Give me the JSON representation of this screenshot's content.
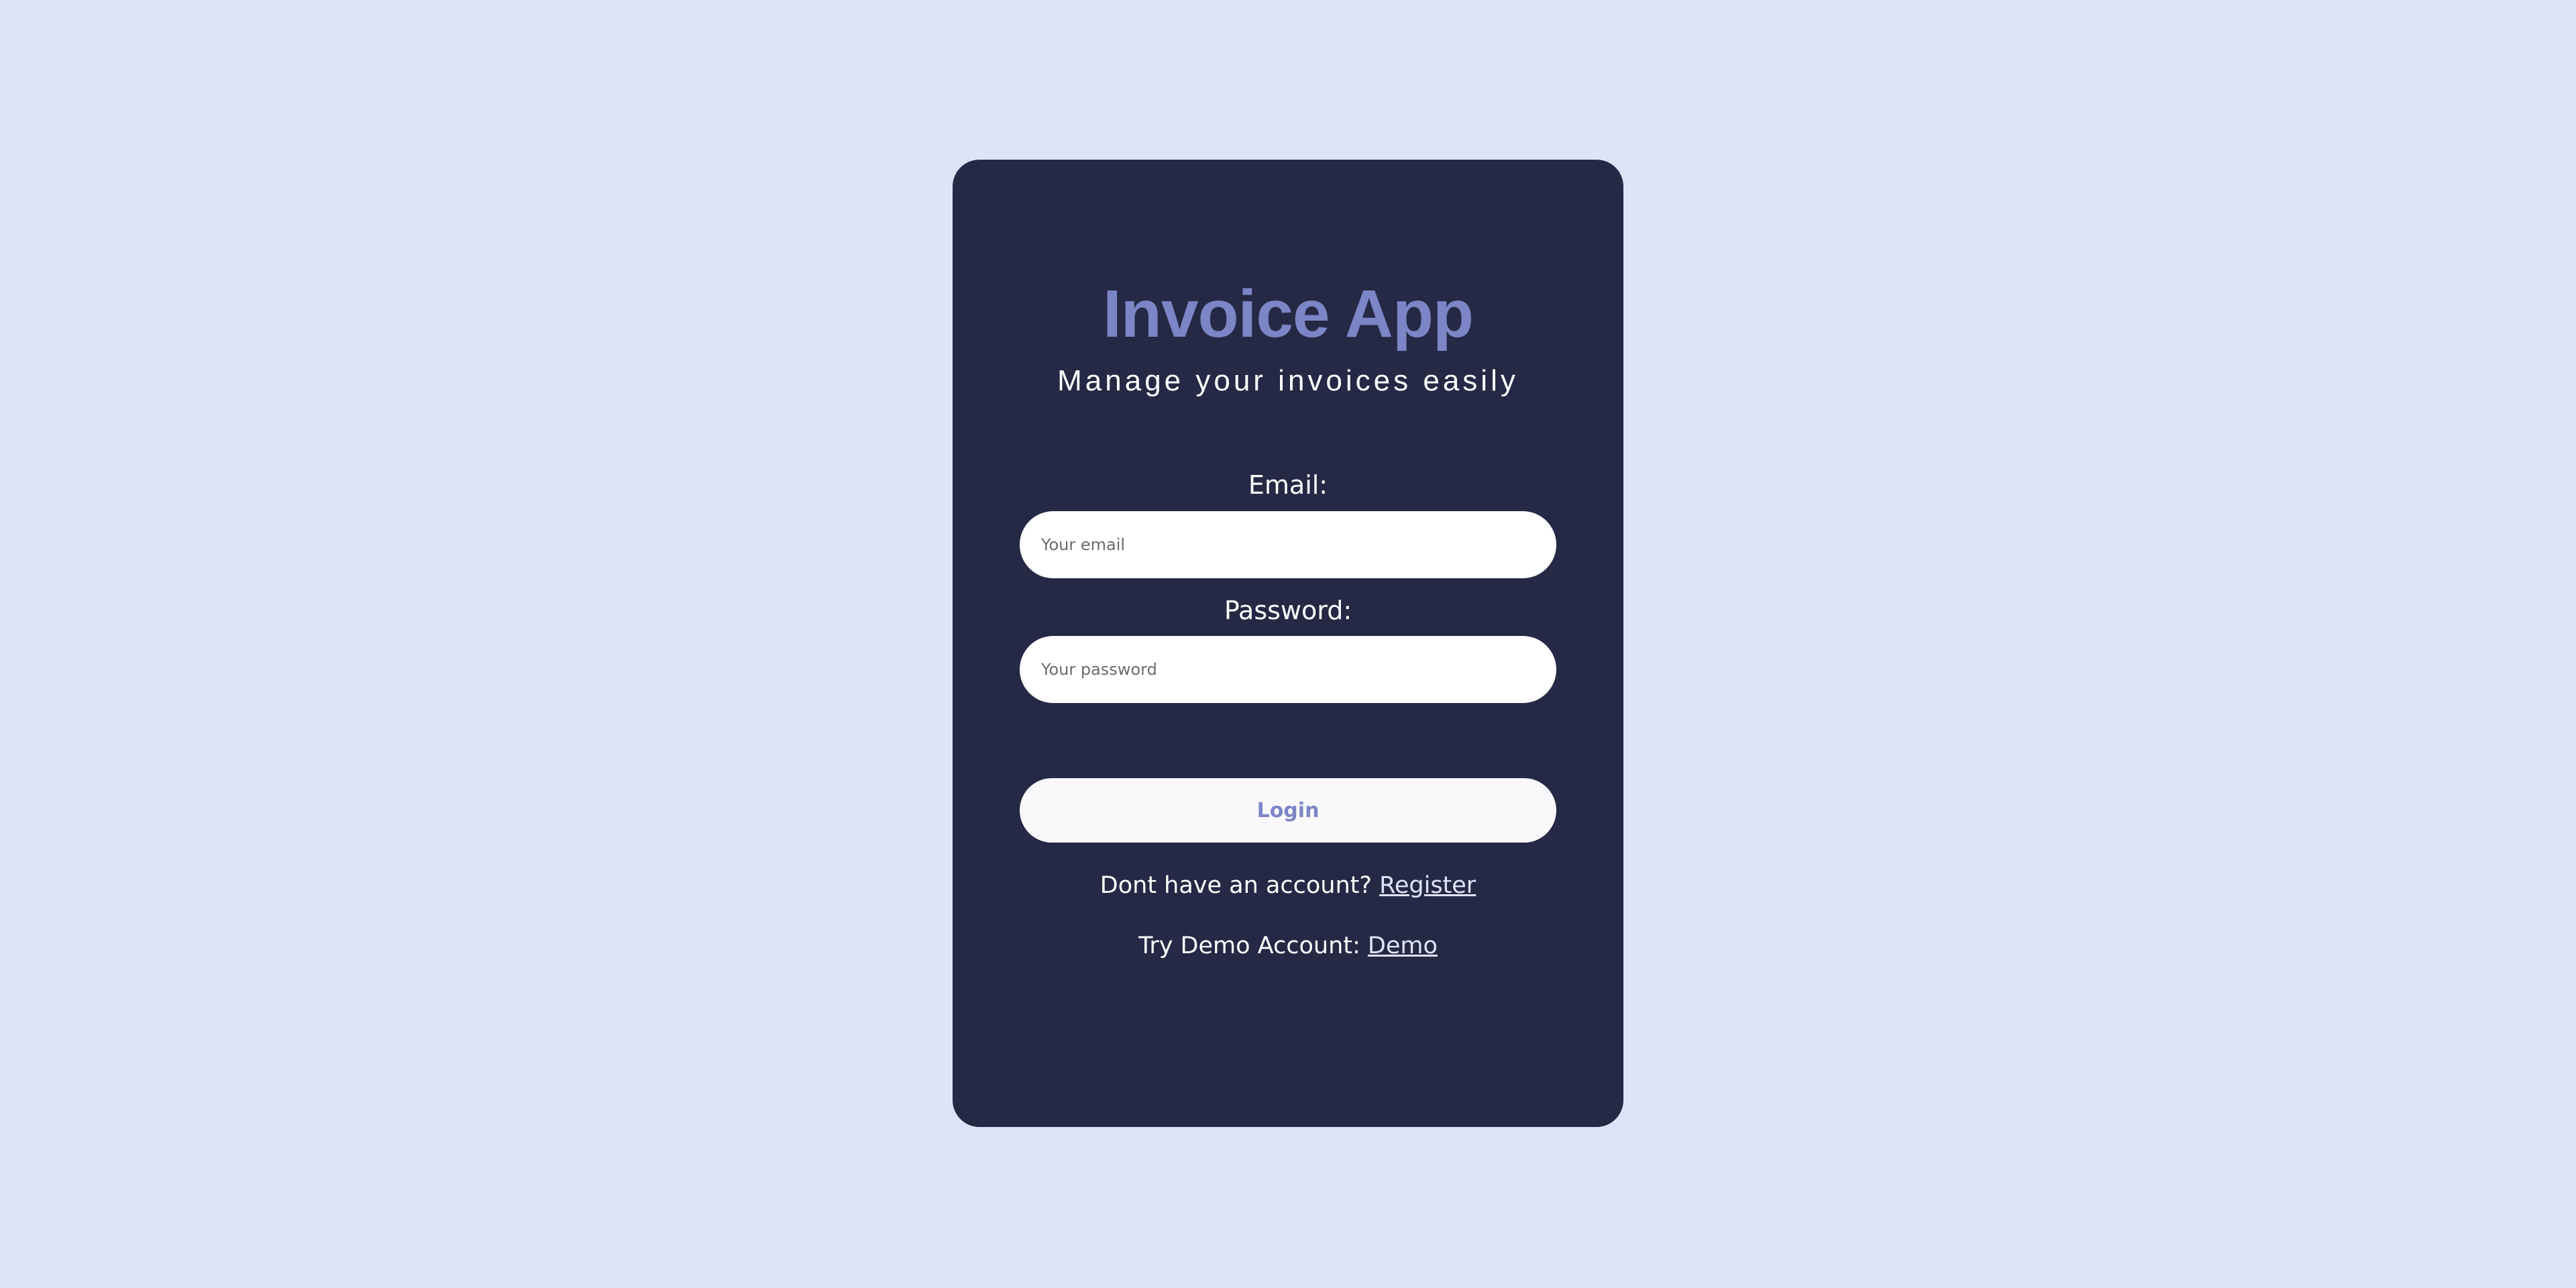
{
  "app": {
    "title": "Invoice App",
    "subtitle": "Manage your invoices easily"
  },
  "form": {
    "email_label": "Email:",
    "email_placeholder": "Your email",
    "email_value": "",
    "password_label": "Password:",
    "password_placeholder": "Your password",
    "password_value": "",
    "login_label": "Login"
  },
  "links": {
    "register_prompt": "Dont have an account?",
    "register_link": "Register",
    "demo_prompt": "Try Demo Account:",
    "demo_link": "Demo"
  },
  "colors": {
    "background": "#dfe3f8",
    "card": "#252945",
    "accent": "#7c85c6",
    "button": "#f8f8fb"
  }
}
